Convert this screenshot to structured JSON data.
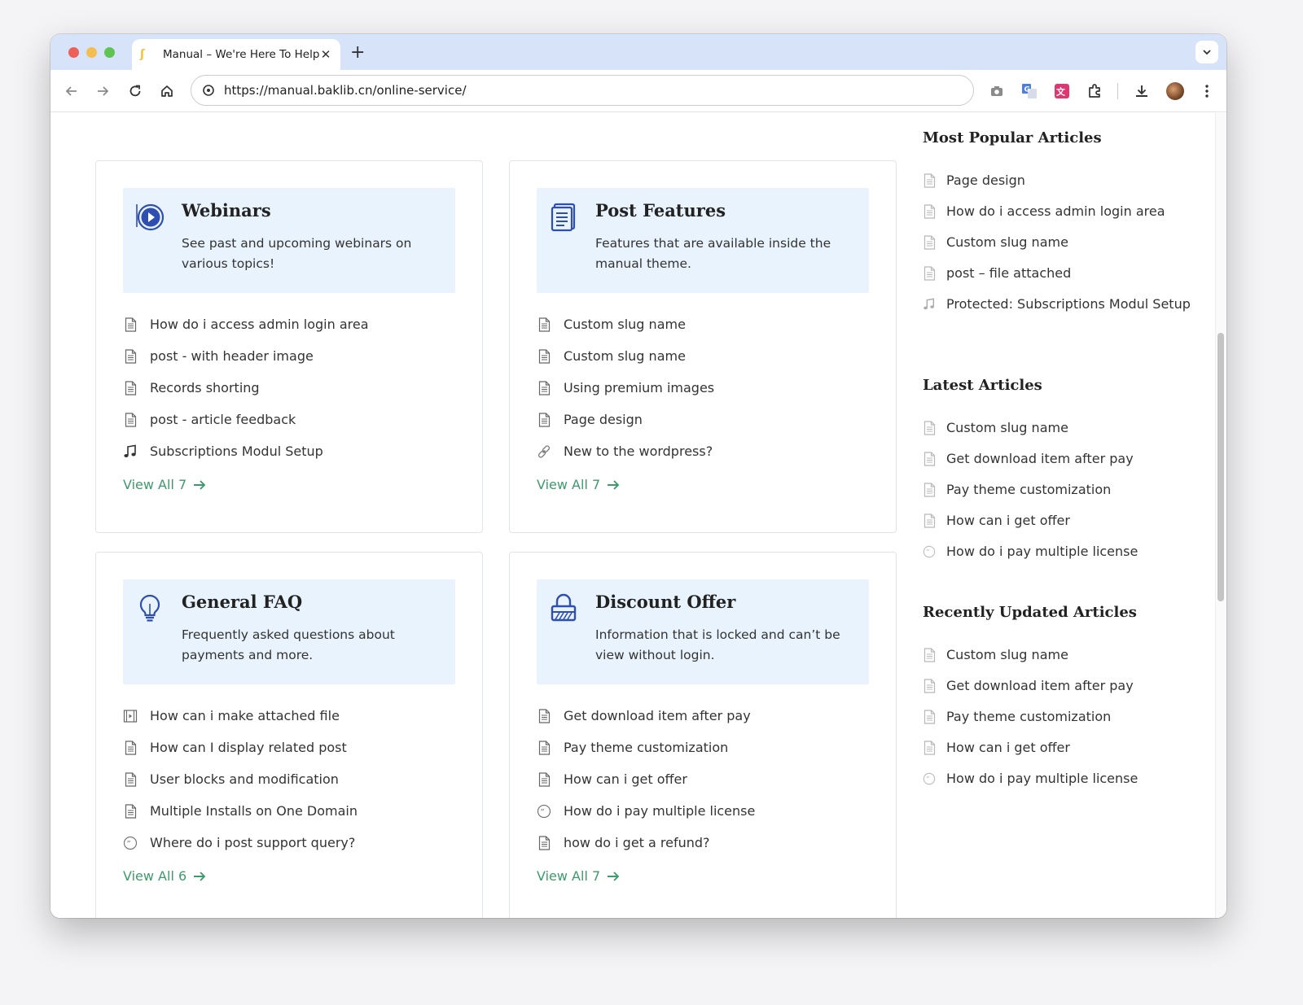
{
  "browser": {
    "tab_title": "Manual – We're Here To Help",
    "tab_close": "✕",
    "new_tab": "+",
    "url": "https://manual.baklib.cn/online-service/"
  },
  "cards": [
    {
      "title": "Webinars",
      "description": "See past and upcoming webinars on various topics!",
      "icon": "play-circle-icon",
      "items": [
        {
          "label": "How do i access admin login area",
          "icon": "document-icon"
        },
        {
          "label": "post - with header image",
          "icon": "document-icon"
        },
        {
          "label": "Records shorting",
          "icon": "document-icon"
        },
        {
          "label": "post - article feedback",
          "icon": "document-icon"
        },
        {
          "label": "Subscriptions Modul Setup",
          "icon": "music-note-icon"
        }
      ],
      "view_all": "View All 7"
    },
    {
      "title": "Post Features",
      "description": "Features that are available inside the manual theme.",
      "icon": "document-list-icon",
      "items": [
        {
          "label": "Custom slug name",
          "icon": "document-icon"
        },
        {
          "label": "Custom slug name",
          "icon": "document-icon"
        },
        {
          "label": "Using premium images",
          "icon": "document-icon"
        },
        {
          "label": "Page design",
          "icon": "document-icon"
        },
        {
          "label": "New to the wordpress?",
          "icon": "link-icon"
        }
      ],
      "view_all": "View All 7"
    },
    {
      "title": "General FAQ",
      "description": "Frequently asked questions about payments and more.",
      "icon": "lightbulb-icon",
      "items": [
        {
          "label": "How can i make attached file",
          "icon": "video-file-icon"
        },
        {
          "label": "How can I display related post",
          "icon": "document-icon"
        },
        {
          "label": "User blocks and modification",
          "icon": "document-icon"
        },
        {
          "label": "Multiple Installs on One Domain",
          "icon": "document-icon"
        },
        {
          "label": "Where do i post support query?",
          "icon": "quote-icon"
        }
      ],
      "view_all": "View All 6"
    },
    {
      "title": "Discount Offer",
      "description": "Information that is locked and can’t be view without login.",
      "icon": "lock-icon",
      "items": [
        {
          "label": "Get download item after pay",
          "icon": "document-icon"
        },
        {
          "label": "Pay theme customization",
          "icon": "document-icon"
        },
        {
          "label": "How can i get offer",
          "icon": "document-icon"
        },
        {
          "label": "How do i pay multiple license",
          "icon": "quote-icon"
        },
        {
          "label": "how do i get a refund?",
          "icon": "document-icon"
        }
      ],
      "view_all": "View All 7"
    }
  ],
  "sidebar": {
    "popular": {
      "title": "Most Popular Articles",
      "items": [
        {
          "label": "Page design",
          "icon": "document-icon"
        },
        {
          "label": "How do i access admin login area",
          "icon": "document-icon"
        },
        {
          "label": "Custom slug name",
          "icon": "document-icon"
        },
        {
          "label": "post – file attached",
          "icon": "document-icon"
        },
        {
          "label": "Protected: Subscriptions Modul Setup",
          "icon": "music-note-icon"
        }
      ]
    },
    "latest": {
      "title": "Latest Articles",
      "items": [
        {
          "label": "Custom slug name",
          "icon": "document-icon"
        },
        {
          "label": "Get download item after pay",
          "icon": "document-icon"
        },
        {
          "label": "Pay theme customization",
          "icon": "document-icon"
        },
        {
          "label": "How can i get offer",
          "icon": "document-icon"
        },
        {
          "label": "How do i pay multiple license",
          "icon": "quote-icon"
        }
      ]
    },
    "updated": {
      "title": "Recently Updated Articles",
      "items": [
        {
          "label": "Custom slug name",
          "icon": "document-icon"
        },
        {
          "label": "Get download item after pay",
          "icon": "document-icon"
        },
        {
          "label": "Pay theme customization",
          "icon": "document-icon"
        },
        {
          "label": "How can i get offer",
          "icon": "document-icon"
        },
        {
          "label": "How do i pay multiple license",
          "icon": "quote-icon"
        }
      ]
    }
  },
  "colors": {
    "accent_green": "#3d9b6b",
    "icon_blue": "#2f4fb0",
    "card_head_bg": "#e8f3fd"
  }
}
